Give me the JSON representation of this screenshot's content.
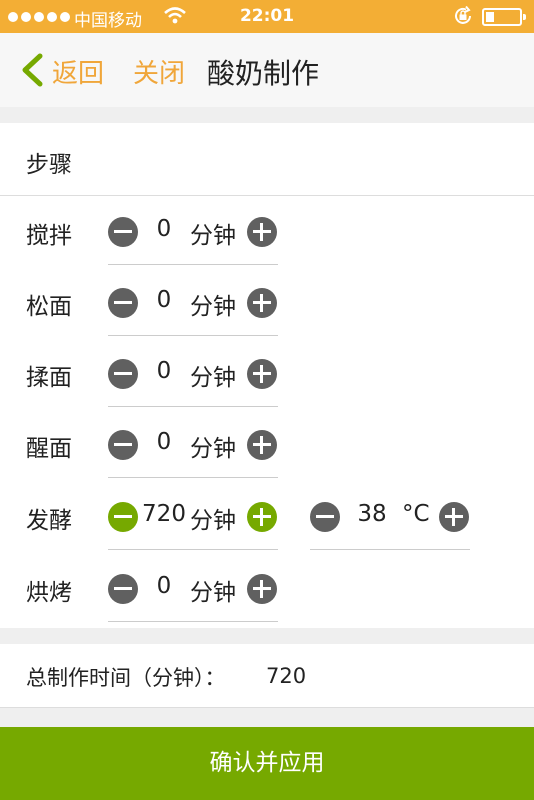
{
  "status_bar": {
    "carrier": "中国移动",
    "time": "22:01",
    "wifi_icon": "wifi-icon",
    "lock_icon": "rotation-lock-icon",
    "battery_icon": "battery-icon"
  },
  "nav": {
    "back_label": "返回",
    "close_label": "关闭",
    "title": "酸奶制作",
    "accent_color": "#f0a63a"
  },
  "steps": {
    "header": "步骤",
    "items": [
      {
        "label": "搅拌",
        "value": "0",
        "unit": "分钟",
        "active": false
      },
      {
        "label": "松面",
        "value": "0",
        "unit": "分钟",
        "active": false
      },
      {
        "label": "揉面",
        "value": "0",
        "unit": "分钟",
        "active": false
      },
      {
        "label": "醒面",
        "value": "0",
        "unit": "分钟",
        "active": false
      },
      {
        "label": "发酵",
        "value": "720",
        "unit": "分钟",
        "active": true
      },
      {
        "label": "烘烤",
        "value": "0",
        "unit": "分钟",
        "active": false
      }
    ],
    "temperature": {
      "value": "38",
      "unit": "°C"
    }
  },
  "total": {
    "label": "总制作时间（分钟）：",
    "value": "720"
  },
  "confirm_label": "确认并应用",
  "colors": {
    "status_bar": "#f3ae35",
    "active_button": "#76a900",
    "inactive_button": "#606060",
    "confirm_bg": "#76a900"
  }
}
